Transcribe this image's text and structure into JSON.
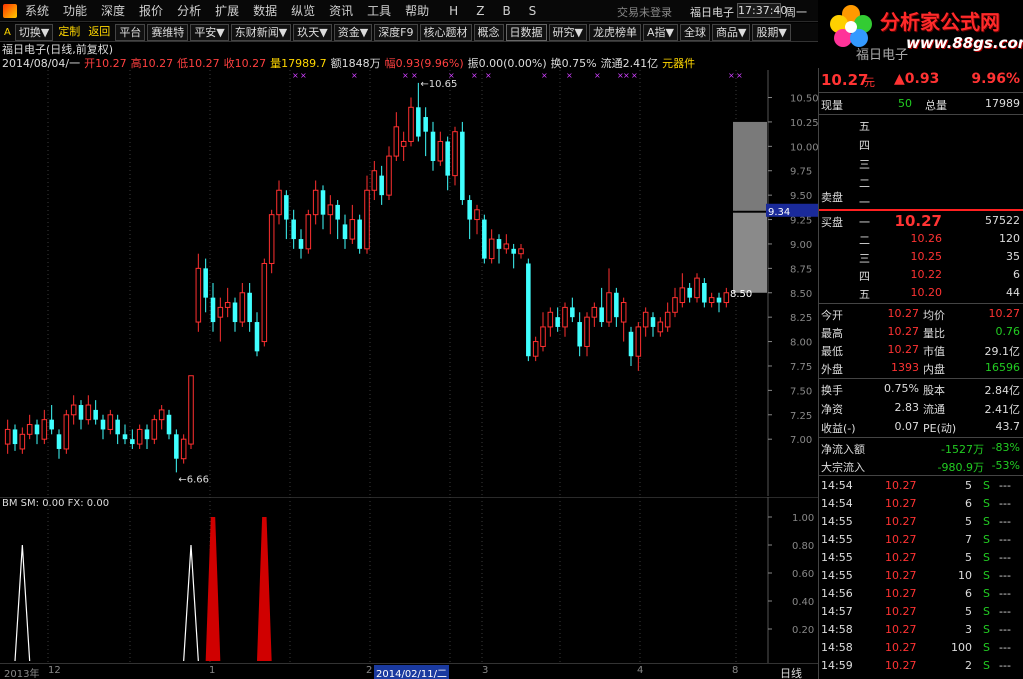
{
  "menu": {
    "items": [
      "系统",
      "功能",
      "深度",
      "报价",
      "分析",
      "扩展",
      "数据",
      "纵览",
      "资讯",
      "工具",
      "帮助"
    ],
    "letters": [
      "H",
      "Z",
      "B",
      "S"
    ],
    "status_text": "交易未登录",
    "stock_name": "福日电子",
    "clock": "17:37:40",
    "weekday": "周一"
  },
  "toolbar": {
    "items": [
      "切换▼",
      "定制",
      "返回",
      "平台",
      "赛维特",
      "平安▼",
      "东财新闻▼",
      "玖天▼",
      "资金▼",
      "深度F9",
      "核心题材",
      "概念",
      "日数据",
      "研究▼",
      "龙虎榜单",
      "A指▼",
      "全球",
      "商品▼",
      "股期▼"
    ]
  },
  "logo": {
    "text": "分析家公式网",
    "url": "www.88gs.com",
    "stock_name": "福日电子"
  },
  "header": {
    "title": "福日电子(日线,前复权)",
    "date": "2014/08/04/一",
    "open_label": "开",
    "open": "10.27",
    "high_label": "高",
    "high": "10.27",
    "low_label": "低",
    "low": "10.27",
    "close_label": "收",
    "close": "10.27",
    "vol_label": "量",
    "vol": "17989.7",
    "amt_label": "额",
    "amt": "1848万",
    "chg_label": "幅",
    "chg": "0.93(9.96%)",
    "amp_label": "振",
    "amp": "0.00(0.00%)",
    "turn_label": "换",
    "turn": "0.75%",
    "float_label": "流通",
    "float": "2.41亿",
    "sector": "元器件"
  },
  "chart": {
    "max_label": "10.65",
    "min_label": "6.66",
    "price_marker_upper": "9.34",
    "price_marker_lower": "8.50",
    "y_ticks": [
      "10.50",
      "10.25",
      "10.00",
      "9.75",
      "9.50",
      "9.25",
      "9.00",
      "8.75",
      "8.50",
      "8.25",
      "8.00",
      "7.75",
      "7.50",
      "7.25",
      "7.00"
    ]
  },
  "indicator": {
    "label": "BM SM: 0.00  FX: 0.00",
    "y_ticks": [
      "1.00",
      "0.80",
      "0.60",
      "0.40",
      "0.20"
    ]
  },
  "date_axis": {
    "labels": [
      "2013年",
      "12",
      "1",
      "2",
      "3",
      "4",
      "8"
    ],
    "selected": "2014/02/11/二",
    "period": "日线"
  },
  "chart_data": {
    "type": "candlestick",
    "title": "福日电子(日线,前复权)",
    "ylim": [
      6.5,
      10.7
    ],
    "candles": [
      {
        "o": 6.95,
        "c": 7.1,
        "h": 7.2,
        "l": 6.85
      },
      {
        "o": 7.1,
        "c": 6.95,
        "h": 7.15,
        "l": 6.88
      },
      {
        "o": 6.9,
        "c": 7.05,
        "h": 7.12,
        "l": 6.85
      },
      {
        "o": 7.05,
        "c": 7.15,
        "h": 7.25,
        "l": 7.0
      },
      {
        "o": 7.15,
        "c": 7.05,
        "h": 7.2,
        "l": 6.95
      },
      {
        "o": 7.0,
        "c": 7.2,
        "h": 7.3,
        "l": 6.95
      },
      {
        "o": 7.2,
        "c": 7.1,
        "h": 7.35,
        "l": 7.05
      },
      {
        "o": 7.05,
        "c": 6.9,
        "h": 7.1,
        "l": 6.8
      },
      {
        "o": 6.9,
        "c": 7.25,
        "h": 7.3,
        "l": 6.85
      },
      {
        "o": 7.25,
        "c": 7.35,
        "h": 7.45,
        "l": 7.15
      },
      {
        "o": 7.35,
        "c": 7.2,
        "h": 7.4,
        "l": 7.1
      },
      {
        "o": 7.2,
        "c": 7.35,
        "h": 7.45,
        "l": 7.15
      },
      {
        "o": 7.3,
        "c": 7.2,
        "h": 7.4,
        "l": 7.15
      },
      {
        "o": 7.2,
        "c": 7.1,
        "h": 7.25,
        "l": 7.0
      },
      {
        "o": 7.1,
        "c": 7.25,
        "h": 7.3,
        "l": 7.05
      },
      {
        "o": 7.2,
        "c": 7.05,
        "h": 7.25,
        "l": 6.95
      },
      {
        "o": 7.05,
        "c": 7.0,
        "h": 7.15,
        "l": 6.95
      },
      {
        "o": 7.0,
        "c": 6.95,
        "h": 7.1,
        "l": 6.9
      },
      {
        "o": 6.95,
        "c": 7.1,
        "h": 7.15,
        "l": 6.9
      },
      {
        "o": 7.1,
        "c": 7.0,
        "h": 7.15,
        "l": 6.9
      },
      {
        "o": 7.0,
        "c": 7.2,
        "h": 7.25,
        "l": 6.95
      },
      {
        "o": 7.2,
        "c": 7.3,
        "h": 7.35,
        "l": 7.1
      },
      {
        "o": 7.25,
        "c": 7.05,
        "h": 7.3,
        "l": 7.0
      },
      {
        "o": 7.05,
        "c": 6.8,
        "h": 7.1,
        "l": 6.66
      },
      {
        "o": 6.8,
        "c": 7.0,
        "h": 7.05,
        "l": 6.75
      },
      {
        "o": 6.95,
        "c": 7.65,
        "h": 7.65,
        "l": 6.9
      },
      {
        "o": 8.2,
        "c": 8.75,
        "h": 8.9,
        "l": 8.1
      },
      {
        "o": 8.75,
        "c": 8.45,
        "h": 8.85,
        "l": 8.3
      },
      {
        "o": 8.45,
        "c": 8.2,
        "h": 8.6,
        "l": 8.1
      },
      {
        "o": 8.25,
        "c": 8.35,
        "h": 8.45,
        "l": 8.0
      },
      {
        "o": 8.35,
        "c": 8.4,
        "h": 8.55,
        "l": 8.25
      },
      {
        "o": 8.4,
        "c": 8.2,
        "h": 8.45,
        "l": 8.1
      },
      {
        "o": 8.2,
        "c": 8.5,
        "h": 8.6,
        "l": 8.15
      },
      {
        "o": 8.5,
        "c": 8.2,
        "h": 8.6,
        "l": 8.1
      },
      {
        "o": 8.2,
        "c": 7.9,
        "h": 8.3,
        "l": 7.85
      },
      {
        "o": 8.0,
        "c": 8.8,
        "h": 8.85,
        "l": 7.95
      },
      {
        "o": 8.8,
        "c": 9.3,
        "h": 9.35,
        "l": 8.7
      },
      {
        "o": 9.3,
        "c": 9.55,
        "h": 9.65,
        "l": 9.2
      },
      {
        "o": 9.5,
        "c": 9.25,
        "h": 9.55,
        "l": 9.05
      },
      {
        "o": 9.25,
        "c": 9.05,
        "h": 9.35,
        "l": 8.95
      },
      {
        "o": 9.05,
        "c": 8.95,
        "h": 9.15,
        "l": 8.85
      },
      {
        "o": 8.95,
        "c": 9.3,
        "h": 9.35,
        "l": 8.9
      },
      {
        "o": 9.3,
        "c": 9.55,
        "h": 9.65,
        "l": 9.2
      },
      {
        "o": 9.55,
        "c": 9.3,
        "h": 9.6,
        "l": 9.15
      },
      {
        "o": 9.3,
        "c": 9.4,
        "h": 9.5,
        "l": 9.1
      },
      {
        "o": 9.4,
        "c": 9.25,
        "h": 9.45,
        "l": 9.05
      },
      {
        "o": 9.2,
        "c": 9.05,
        "h": 9.3,
        "l": 8.95
      },
      {
        "o": 9.05,
        "c": 9.25,
        "h": 9.4,
        "l": 9.0
      },
      {
        "o": 9.25,
        "c": 8.95,
        "h": 9.3,
        "l": 8.9
      },
      {
        "o": 8.95,
        "c": 9.55,
        "h": 9.7,
        "l": 8.9
      },
      {
        "o": 9.55,
        "c": 9.75,
        "h": 9.85,
        "l": 9.45
      },
      {
        "o": 9.7,
        "c": 9.5,
        "h": 9.8,
        "l": 9.4
      },
      {
        "o": 9.5,
        "c": 9.9,
        "h": 10.0,
        "l": 9.45
      },
      {
        "o": 9.9,
        "c": 10.2,
        "h": 10.35,
        "l": 9.85
      },
      {
        "o": 10.0,
        "c": 10.05,
        "h": 10.15,
        "l": 9.85
      },
      {
        "o": 10.05,
        "c": 10.4,
        "h": 10.5,
        "l": 10.0
      },
      {
        "o": 10.4,
        "c": 10.1,
        "h": 10.65,
        "l": 10.05
      },
      {
        "o": 10.3,
        "c": 10.15,
        "h": 10.4,
        "l": 9.9
      },
      {
        "o": 10.15,
        "c": 9.85,
        "h": 10.25,
        "l": 9.75
      },
      {
        "o": 9.85,
        "c": 10.05,
        "h": 10.15,
        "l": 9.8
      },
      {
        "o": 10.05,
        "c": 9.7,
        "h": 10.1,
        "l": 9.55
      },
      {
        "o": 9.7,
        "c": 10.15,
        "h": 10.2,
        "l": 9.6
      },
      {
        "o": 10.15,
        "c": 9.45,
        "h": 10.25,
        "l": 9.4
      },
      {
        "o": 9.45,
        "c": 9.25,
        "h": 9.5,
        "l": 9.05
      },
      {
        "o": 9.25,
        "c": 9.35,
        "h": 9.4,
        "l": 9.1
      },
      {
        "o": 9.25,
        "c": 8.85,
        "h": 9.3,
        "l": 8.8
      },
      {
        "o": 8.85,
        "c": 9.05,
        "h": 9.15,
        "l": 8.8
      },
      {
        "o": 9.05,
        "c": 8.95,
        "h": 9.1,
        "l": 8.8
      },
      {
        "o": 8.95,
        "c": 9.0,
        "h": 9.1,
        "l": 8.9
      },
      {
        "o": 8.95,
        "c": 8.9,
        "h": 9.0,
        "l": 8.75
      },
      {
        "o": 8.9,
        "c": 8.95,
        "h": 9.0,
        "l": 8.85
      },
      {
        "o": 8.8,
        "c": 7.85,
        "h": 8.85,
        "l": 7.8
      },
      {
        "o": 7.85,
        "c": 8.0,
        "h": 8.05,
        "l": 7.8
      },
      {
        "o": 7.95,
        "c": 8.15,
        "h": 8.3,
        "l": 7.9
      },
      {
        "o": 8.15,
        "c": 8.3,
        "h": 8.35,
        "l": 8.05
      },
      {
        "o": 8.25,
        "c": 8.15,
        "h": 8.35,
        "l": 8.1
      },
      {
        "o": 8.15,
        "c": 8.35,
        "h": 8.4,
        "l": 8.05
      },
      {
        "o": 8.35,
        "c": 8.25,
        "h": 8.45,
        "l": 8.2
      },
      {
        "o": 8.2,
        "c": 7.95,
        "h": 8.3,
        "l": 7.85
      },
      {
        "o": 7.95,
        "c": 8.25,
        "h": 8.3,
        "l": 7.85
      },
      {
        "o": 8.25,
        "c": 8.35,
        "h": 8.4,
        "l": 8.15
      },
      {
        "o": 8.35,
        "c": 8.2,
        "h": 8.55,
        "l": 8.15
      },
      {
        "o": 8.2,
        "c": 8.5,
        "h": 8.75,
        "l": 8.15
      },
      {
        "o": 8.5,
        "c": 8.25,
        "h": 8.55,
        "l": 8.15
      },
      {
        "o": 8.2,
        "c": 8.4,
        "h": 8.45,
        "l": 8.0
      },
      {
        "o": 8.1,
        "c": 7.85,
        "h": 8.15,
        "l": 7.75
      },
      {
        "o": 7.85,
        "c": 8.15,
        "h": 8.2,
        "l": 7.7
      },
      {
        "o": 8.15,
        "c": 8.3,
        "h": 8.35,
        "l": 8.05
      },
      {
        "o": 8.25,
        "c": 8.15,
        "h": 8.3,
        "l": 8.05
      },
      {
        "o": 8.1,
        "c": 8.2,
        "h": 8.25,
        "l": 8.05
      },
      {
        "o": 8.15,
        "c": 8.3,
        "h": 8.4,
        "l": 8.1
      },
      {
        "o": 8.3,
        "c": 8.45,
        "h": 8.55,
        "l": 8.25
      },
      {
        "o": 8.4,
        "c": 8.55,
        "h": 8.7,
        "l": 8.35
      },
      {
        "o": 8.55,
        "c": 8.45,
        "h": 8.6,
        "l": 8.4
      },
      {
        "o": 8.45,
        "c": 8.65,
        "h": 8.7,
        "l": 8.4
      },
      {
        "o": 8.6,
        "c": 8.4,
        "h": 8.65,
        "l": 8.35
      },
      {
        "o": 8.4,
        "c": 8.45,
        "h": 8.5,
        "l": 8.35
      },
      {
        "o": 8.45,
        "c": 8.4,
        "h": 8.5,
        "l": 8.3
      },
      {
        "o": 8.4,
        "c": 8.5,
        "h": 8.55,
        "l": 8.35
      }
    ],
    "indicator_peaks": [
      {
        "index": 2,
        "value": 0.8,
        "color": "white"
      },
      {
        "index": 25,
        "value": 0.8,
        "color": "white"
      },
      {
        "index": 28,
        "value": 1.0,
        "color": "red"
      },
      {
        "index": 35,
        "value": 1.0,
        "color": "red"
      }
    ]
  },
  "quote": {
    "price": "10.27",
    "unit": "元",
    "change": "▲0.93",
    "pct": "9.96%",
    "vol_label": "现量",
    "vol": "50",
    "total_label": "总量",
    "total": "17989",
    "sell_levels": [
      "五",
      "四",
      "三",
      "二",
      "一"
    ],
    "sell_label": "卖盘",
    "buy_label": "买盘",
    "buy": [
      {
        "label": "一",
        "price": "10.27",
        "vol": "57522"
      },
      {
        "label": "二",
        "price": "10.26",
        "vol": "120"
      },
      {
        "label": "三",
        "price": "10.25",
        "vol": "35"
      },
      {
        "label": "四",
        "price": "10.22",
        "vol": "6"
      },
      {
        "label": "五",
        "price": "10.20",
        "vol": "44"
      }
    ],
    "stats": [
      {
        "l1": "今开",
        "v1": "10.27",
        "l2": "均价",
        "v2": "10.27",
        "c1": "red",
        "c2": "red"
      },
      {
        "l1": "最高",
        "v1": "10.27",
        "l2": "量比",
        "v2": "0.76",
        "c1": "red",
        "c2": "green"
      },
      {
        "l1": "最低",
        "v1": "10.27",
        "l2": "市值",
        "v2": "29.1亿",
        "c1": "red",
        "c2": "white"
      },
      {
        "l1": "外盘",
        "v1": "1393",
        "l2": "内盘",
        "v2": "16596",
        "c1": "red",
        "c2": "green"
      }
    ],
    "stats2": [
      {
        "l1": "换手",
        "v1": "0.75%",
        "l2": "股本",
        "v2": "2.84亿"
      },
      {
        "l1": "净资",
        "v1": "2.83",
        "l2": "流通",
        "v2": "2.41亿"
      },
      {
        "l1": "收益(-)",
        "v1": "0.07",
        "l2": "PE(动)",
        "v2": "43.7"
      }
    ],
    "flow": [
      {
        "label": "净流入额",
        "v1": "-1527万",
        "v2": "-83%"
      },
      {
        "label": "大宗流入",
        "v1": "-980.9万",
        "v2": "-53%"
      }
    ],
    "ticks": [
      {
        "t": "14:54",
        "p": "10.27",
        "v": "5",
        "s": "S"
      },
      {
        "t": "14:54",
        "p": "10.27",
        "v": "6",
        "s": "S"
      },
      {
        "t": "14:55",
        "p": "10.27",
        "v": "5",
        "s": "S"
      },
      {
        "t": "14:55",
        "p": "10.27",
        "v": "7",
        "s": "S"
      },
      {
        "t": "14:55",
        "p": "10.27",
        "v": "5",
        "s": "S"
      },
      {
        "t": "14:55",
        "p": "10.27",
        "v": "10",
        "s": "S"
      },
      {
        "t": "14:56",
        "p": "10.27",
        "v": "6",
        "s": "S"
      },
      {
        "t": "14:57",
        "p": "10.27",
        "v": "5",
        "s": "S"
      },
      {
        "t": "14:58",
        "p": "10.27",
        "v": "3",
        "s": "S"
      },
      {
        "t": "14:58",
        "p": "10.27",
        "v": "100",
        "s": "S"
      },
      {
        "t": "14:59",
        "p": "10.27",
        "v": "2",
        "s": "S"
      }
    ],
    "dash": "---"
  }
}
